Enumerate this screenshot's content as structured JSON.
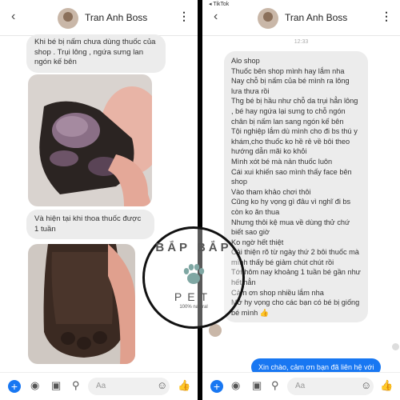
{
  "left": {
    "contact_name": "Tran Anh Boss",
    "message_1": "Khi bé bị nấm chưa dùng thuốc của shop . Trụi lông , ngứa sưng lan ngón kế bên",
    "message_2": "Và hiện tại khi thoa thuốc được 1 tuần",
    "composer_placeholder": "Aa"
  },
  "right": {
    "carrier": "◂ TikTok",
    "contact_name": "Tran Anh Boss",
    "time": "12:33",
    "message": "Alo shop\nThuốc bên shop mình hay lắm nha\nNay chỗ bị nấm của bé mình ra lông lưa thưa rồi\nThg bé bị hầu như chỗ da trụi hẳn lông , bé hay ngứa lại sưng to chỗ ngón chân bị nấm lan sang ngón kế bên\nTội nghiệp lắm dù mình cho đi bs thú y khám,cho thuốc ko hề rẻ về bôi theo hướng dẫn mãi ko khỏi\nMình xót bé mà nản thuốc luôn\nCái xui khiến sao mình thấy face bên shop\nVào tham khảo chơi thôi\nCũng ko hy vọng gì đâu vì nghĩ đi bs còn ko ăn thua\nNhưng thôi kệ mua về dùng thử chứ biết sao giờ\nKo ngờ hết thiệt\nCải thiện rõ từ ngày thứ 2 bôi thuốc mà mình thấy bé giảm chút chút rồi\nTới hôm nay khoảng 1 tuần bé gần như hết hẳn\nCảm ơn shop nhiều lắm nha\nMở hy vọng cho các bạn có bé bị giống bé mình 👍",
    "reply": "Xin chào, cảm ơn bạn đã liên hệ với",
    "composer_placeholder": "Aa"
  },
  "watermark": {
    "top": "BẮP BẮP",
    "bottom": "PET",
    "sub": "100% natural",
    "faint": "Bắp Bắp Pet Shop"
  },
  "colors": {
    "accent": "#1877f2",
    "bubble": "#ececec"
  }
}
